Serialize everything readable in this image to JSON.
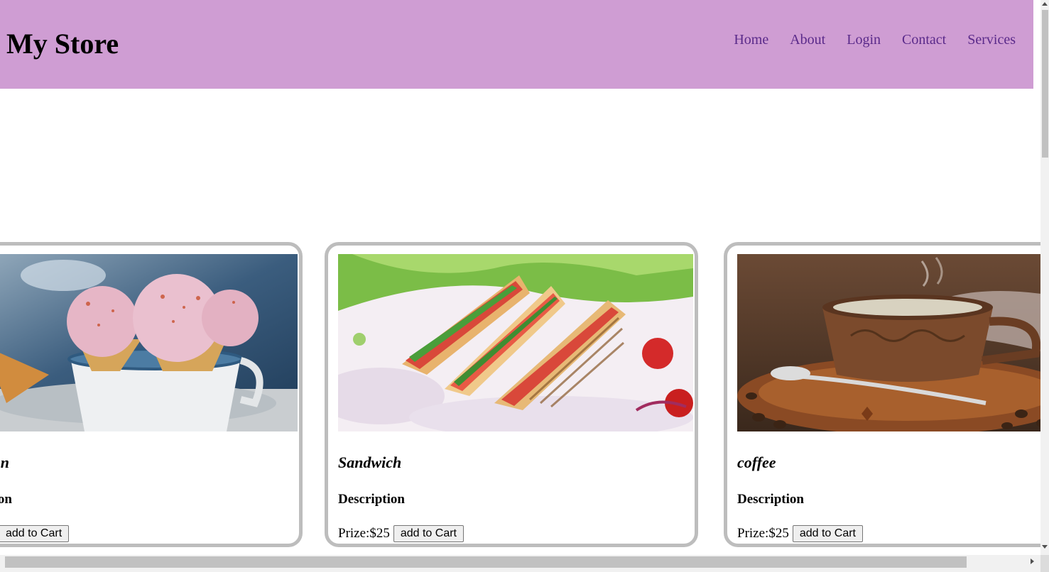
{
  "header": {
    "brand": "My Store",
    "nav": [
      "Home",
      "About",
      "Login",
      "Contact",
      "Services"
    ]
  },
  "cards": [
    {
      "title": "n",
      "description": "on",
      "price": "",
      "button": "add to Cart",
      "image_icon": "ice-cream-image"
    },
    {
      "title": "Sandwich",
      "description": "Description",
      "price": "Prize:$25",
      "button": "add to Cart",
      "image_icon": "sandwich-image"
    },
    {
      "title": "coffee",
      "description": "Description",
      "price": "Prize:$25",
      "button": "add to Cart",
      "image_icon": "coffee-image"
    }
  ],
  "colors": {
    "header_bg": "#cf9dd3",
    "nav_link": "#5a2a8a",
    "card_border": "#bdbdbd"
  }
}
